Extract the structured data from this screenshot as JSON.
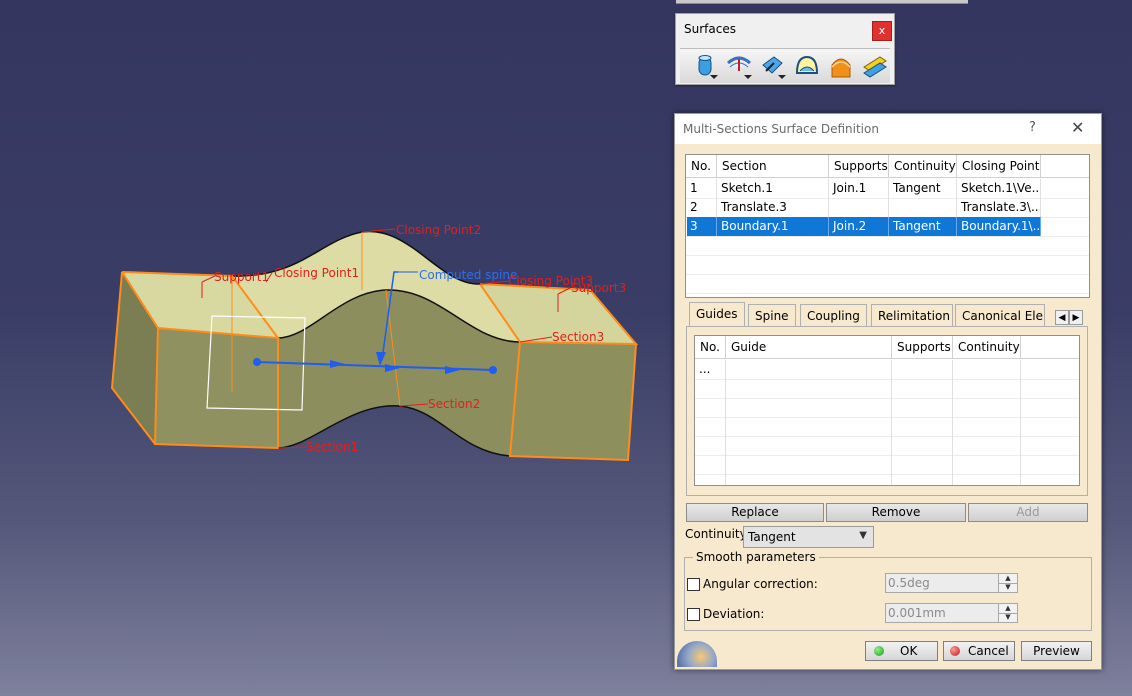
{
  "viewport": {
    "labels": {
      "closing_point2": "Closing Point2",
      "support1": "Support1",
      "closing_point1": "Closing Point1",
      "computed_spine": "Computed spine",
      "closing_point3": "Closing Point3",
      "support3": "Support3",
      "section3": "Section3",
      "section2": "Section2",
      "section1": "Section1"
    }
  },
  "surfaces_toolbar": {
    "title": "Surfaces",
    "close_label": "x",
    "icons": [
      "extrude-surface-icon",
      "offset-surface-icon",
      "sweep-surface-icon",
      "fill-surface-icon",
      "multi-sections-surface-icon",
      "blend-surface-icon"
    ]
  },
  "dialog": {
    "title": "Multi-Sections Surface Definition",
    "help_label": "?",
    "close_label": "✕",
    "sections_table": {
      "columns": [
        "No.",
        "Section",
        "Supports",
        "Continuity",
        "Closing Point"
      ],
      "rows": [
        {
          "no": "1",
          "section": "Sketch.1",
          "supports": "Join.1",
          "continuity": "Tangent",
          "closing_point": "Sketch.1\\Ve..."
        },
        {
          "no": "2",
          "section": "Translate.3",
          "supports": "",
          "continuity": "",
          "closing_point": "Translate.3\\..."
        },
        {
          "no": "3",
          "section": "Boundary.1",
          "supports": "Join.2",
          "continuity": "Tangent",
          "closing_point": "Boundary.1\\..."
        }
      ],
      "selected_row": 3
    },
    "tabs": [
      "Guides",
      "Spine",
      "Coupling",
      "Relimitation",
      "Canonical Eleme"
    ],
    "active_tab": "Guides",
    "guides_table": {
      "columns": [
        "No.",
        "Guide",
        "Supports",
        "Continuity"
      ],
      "rows": [
        {
          "no": "...",
          "guide": "",
          "supports": "",
          "continuity": ""
        }
      ]
    },
    "buttons": {
      "replace": "Replace",
      "remove": "Remove",
      "add": "Add"
    },
    "continuity_label": "Continuity:",
    "continuity_value": "Tangent",
    "smooth_parameters": {
      "legend": "Smooth parameters",
      "angular_correction_label": "Angular correction:",
      "angular_correction_value": "0.5deg",
      "deviation_label": "Deviation:",
      "deviation_value": "0.001mm"
    },
    "ok_label": "OK",
    "cancel_label": "Cancel",
    "preview_label": "Preview",
    "colors": {
      "selection": "#0f78d7",
      "dialog_bg": "#f7e9cd",
      "edge_highlight": "#ff8c1a",
      "label_red": "#e0201c",
      "label_blue": "#2a6ff0"
    }
  }
}
